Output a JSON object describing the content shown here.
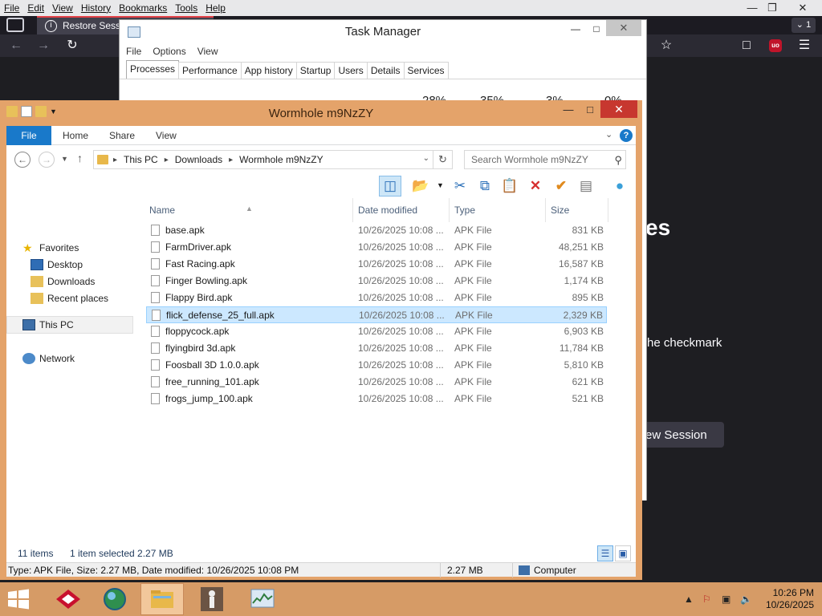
{
  "firefox": {
    "menu": [
      "File",
      "Edit",
      "View",
      "History",
      "Bookmarks",
      "Tools",
      "Help"
    ],
    "tab_title": "Restore Session",
    "tab_count": "1",
    "content_heading_fragment": "es",
    "content_line_fragment": "he checkmark",
    "content_button_fragment": "ew Session"
  },
  "task_manager": {
    "title": "Task Manager",
    "menu": [
      "File",
      "Options",
      "View"
    ],
    "tabs": [
      "Processes",
      "Performance",
      "App history",
      "Startup",
      "Users",
      "Details",
      "Services"
    ],
    "active_tab": "Processes",
    "percents": [
      "28%",
      "35%",
      "3%",
      "0%"
    ]
  },
  "explorer": {
    "title": "Wormhole m9NzZY",
    "ribbon_tabs": {
      "file": "File",
      "home": "Home",
      "share": "Share",
      "view": "View"
    },
    "breadcrumb": [
      "This PC",
      "Downloads",
      "Wormhole m9NzZY"
    ],
    "search_placeholder": "Search Wormhole m9NzZY",
    "nav": {
      "favorites": "Favorites",
      "desktop": "Desktop",
      "downloads": "Downloads",
      "recent": "Recent places",
      "this_pc": "This PC",
      "network": "Network"
    },
    "columns": {
      "name": "Name",
      "date": "Date modified",
      "type": "Type",
      "size": "Size"
    },
    "files": [
      {
        "name": "base.apk",
        "date": "10/26/2025 10:08 ...",
        "type": "APK File",
        "size": "831 KB"
      },
      {
        "name": "FarmDriver.apk",
        "date": "10/26/2025 10:08 ...",
        "type": "APK File",
        "size": "48,251 KB"
      },
      {
        "name": "Fast Racing.apk",
        "date": "10/26/2025 10:08 ...",
        "type": "APK File",
        "size": "16,587 KB"
      },
      {
        "name": "Finger Bowling.apk",
        "date": "10/26/2025 10:08 ...",
        "type": "APK File",
        "size": "1,174 KB"
      },
      {
        "name": "Flappy Bird.apk",
        "date": "10/26/2025 10:08 ...",
        "type": "APK File",
        "size": "895 KB"
      },
      {
        "name": "flick_defense_25_full.apk",
        "date": "10/26/2025 10:08 ...",
        "type": "APK File",
        "size": "2,329 KB"
      },
      {
        "name": "floppycock.apk",
        "date": "10/26/2025 10:08 ...",
        "type": "APK File",
        "size": "6,903 KB"
      },
      {
        "name": "flyingbird 3d.apk",
        "date": "10/26/2025 10:08 ...",
        "type": "APK File",
        "size": "11,784 KB"
      },
      {
        "name": "Foosball 3D 1.0.0.apk",
        "date": "10/26/2025 10:08 ...",
        "type": "APK File",
        "size": "5,810 KB"
      },
      {
        "name": "free_running_101.apk",
        "date": "10/26/2025 10:08 ...",
        "type": "APK File",
        "size": "621 KB"
      },
      {
        "name": "frogs_jump_100.apk",
        "date": "10/26/2025 10:08 ...",
        "type": "APK File",
        "size": "521 KB"
      }
    ],
    "selected_file": "flick_defense_25_full.apk",
    "status": {
      "items": "11 items",
      "selected": "1 item selected  2.27 MB"
    },
    "details": {
      "info": "Type: APK File, Size: 2.27 MB, Date modified: 10/26/2025 10:08 PM",
      "size": "2.27 MB",
      "location": "Computer"
    }
  },
  "taskbar": {
    "time": "10:26 PM",
    "date": "10/26/2025"
  },
  "colors": {
    "window_frame": "#e4a36a",
    "taskbar": "#d69b66",
    "selection": "#cce8ff",
    "accent": "#1979ca",
    "close": "#c7372f"
  },
  "icons": {
    "cut": "cut-icon",
    "copy": "copy-icon",
    "paste": "paste-icon",
    "delete": "delete-icon",
    "properties": "checkmark-icon",
    "rename": "rename-icon",
    "start": "windows-start-icon"
  }
}
